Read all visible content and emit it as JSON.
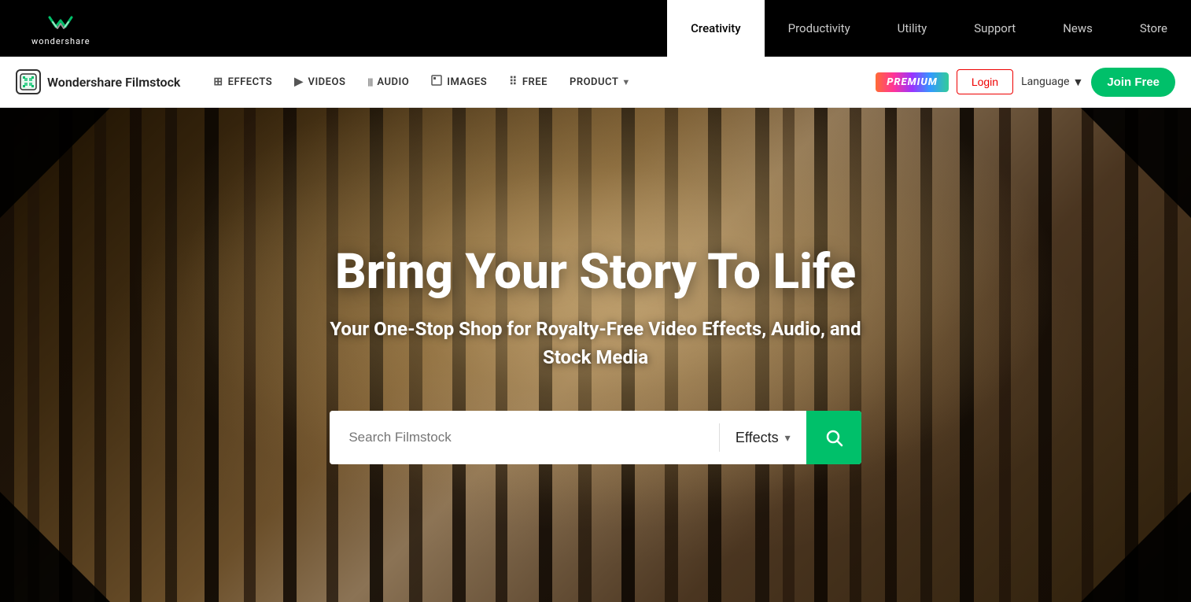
{
  "topNav": {
    "logo": {
      "icon_symbol": "❖",
      "brand": "wondershare"
    },
    "links": [
      {
        "id": "creativity",
        "label": "Creativity",
        "active": true
      },
      {
        "id": "productivity",
        "label": "Productivity",
        "active": false
      },
      {
        "id": "utility",
        "label": "Utility",
        "active": false
      },
      {
        "id": "support",
        "label": "Support",
        "active": false
      },
      {
        "id": "news",
        "label": "News",
        "active": false
      },
      {
        "id": "store",
        "label": "Store",
        "active": false
      }
    ]
  },
  "secondNav": {
    "brand": {
      "name": "Wondershare Filmstock"
    },
    "links": [
      {
        "id": "effects",
        "label": "EFFECTS",
        "icon": "⊞"
      },
      {
        "id": "videos",
        "label": "VIDEOS",
        "icon": "▶"
      },
      {
        "id": "audio",
        "label": "AUDIO",
        "icon": "|||"
      },
      {
        "id": "images",
        "label": "IMAGES",
        "icon": "⬜"
      },
      {
        "id": "free",
        "label": "FREE",
        "icon": "⠿"
      },
      {
        "id": "product",
        "label": "PRODUCT",
        "icon": "",
        "hasArrow": true
      }
    ],
    "premium_label": "PREMIUM",
    "login_label": "Login",
    "language_label": "Language",
    "join_free_label": "Join Free"
  },
  "hero": {
    "title": "Bring Your Story To Life",
    "subtitle": "Your One-Stop Shop for Royalty-Free Video Effects, Audio, and\nStock Media",
    "search": {
      "placeholder": "Search Filmstock",
      "category": "Effects",
      "button_icon": "search"
    }
  }
}
